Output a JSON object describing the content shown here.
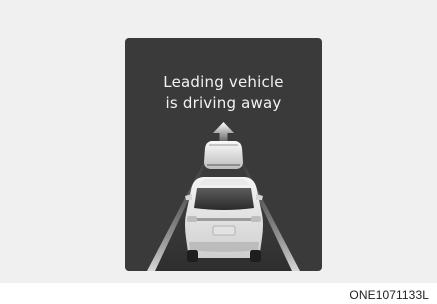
{
  "notice": {
    "line1": "Leading vehicle",
    "line2": "is driving away"
  },
  "figure_code": "ONE1071133L",
  "icons": {
    "arrow": "arrow-up-icon",
    "leading_vehicle": "leading-vehicle-icon",
    "own_vehicle": "own-vehicle-rear-icon",
    "lane_lines": "lane-lines-icon"
  },
  "colors": {
    "page_background": "#f0f0f0",
    "display_background": "#3a3a3a",
    "text": "#f2f2f2"
  }
}
